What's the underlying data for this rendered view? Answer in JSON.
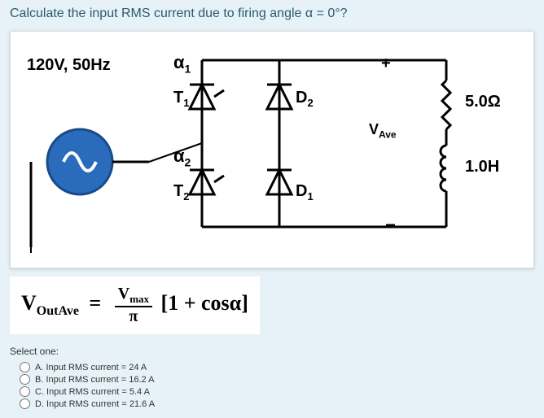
{
  "question": "Calculate the input RMS current due to firing angle α = 0°?",
  "circuit": {
    "source": "120V, 50Hz",
    "alpha1": "α",
    "alpha1_sub": "1",
    "t1": "T",
    "t1_sub": "1",
    "d2": "D",
    "d2_sub": "2",
    "alpha2": "α",
    "alpha2_sub": "2",
    "t2": "T",
    "t2_sub": "2",
    "d1": "D",
    "d1_sub": "1",
    "plus": "+",
    "minus": "−",
    "vave": "V",
    "vave_sub": "Ave",
    "r": "5.0Ω",
    "l": "1.0H"
  },
  "equation": {
    "lhs_v": "V",
    "lhs_sub": "OutAve",
    "eq": "=",
    "num_v": "V",
    "num_sub": "max",
    "den": "π",
    "bracket": "[1 + cosα]"
  },
  "answers": {
    "prompt": "Select one:",
    "options": [
      "A. Input RMS current = 24 A",
      "B. Input RMS current = 16.2 A",
      "C. Input RMS current = 5.4 A",
      "D. Input RMS current = 21.6 A"
    ]
  }
}
